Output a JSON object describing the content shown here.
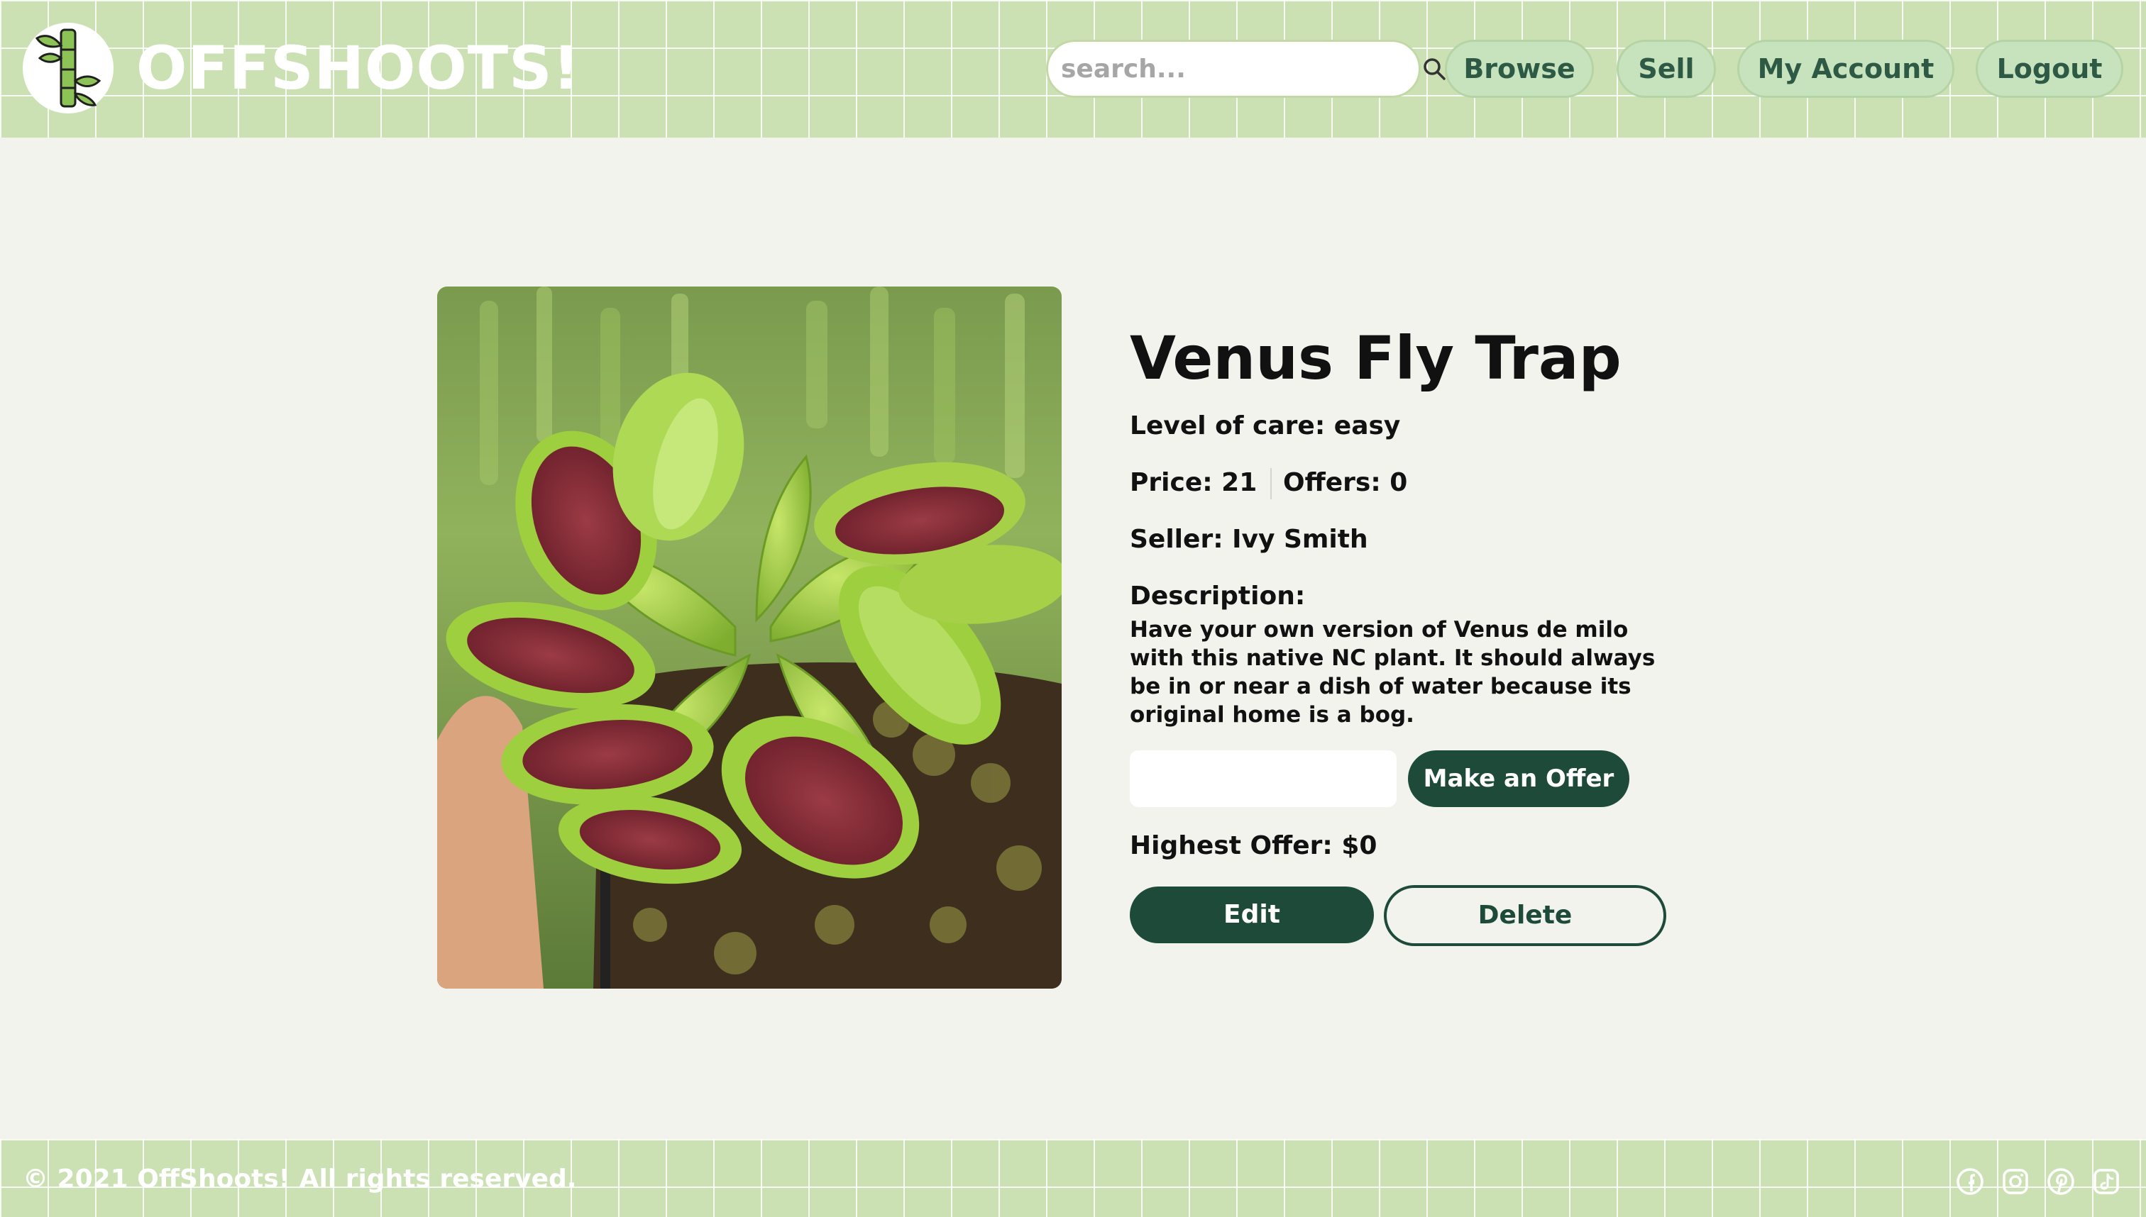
{
  "header": {
    "brand": "OFFSHOOTS!",
    "search_placeholder": "search...",
    "nav": {
      "browse": "Browse",
      "sell": "Sell",
      "account": "My Account",
      "logout": "Logout"
    }
  },
  "product": {
    "title": "Venus Fly Trap",
    "care": "Level of care: easy",
    "price": "Price: 21",
    "offers": "Offers: 0",
    "seller": "Seller: Ivy Smith",
    "description_label": "Description:",
    "description": "Have your own version of Venus de milo with this native NC plant. It should always be in or near a dish of water because its original home is a bog.",
    "offer_value": "",
    "offer_button": "Make an Offer",
    "highest_offer": "Highest Offer: $0",
    "edit_button": "Edit",
    "delete_button": "Delete"
  },
  "footer": {
    "copyright": "© 2021 OffShoots! All rights reserved.",
    "social_icons": [
      "facebook-icon",
      "instagram-icon",
      "pinterest-icon",
      "tiktok-icon"
    ]
  },
  "colors": {
    "header_bg": "#cbe0b3",
    "accent_dark": "#1e4a3a",
    "nav_pill": "#c7e3bd",
    "page_bg": "#f3f3ee"
  }
}
